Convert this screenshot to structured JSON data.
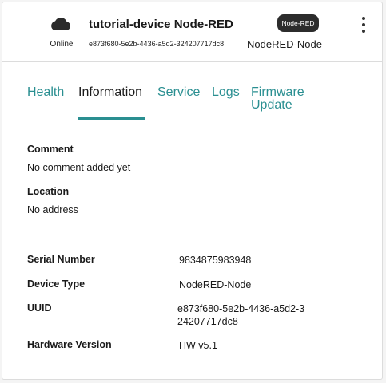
{
  "device": {
    "status": "Online",
    "name": "tutorial-device Node-RED",
    "uuid": "e873f680-5e2b-4436-a5d2-324207717dc8",
    "badge": "Node-RED",
    "type": "NodeRED-Node",
    "status_icon": "cloud-icon",
    "menu_icon": "more-vertical-icon"
  },
  "tabs": [
    {
      "label": "Health",
      "active": false
    },
    {
      "label": "Information",
      "active": true
    },
    {
      "label": "Service",
      "active": false
    },
    {
      "label": "Logs",
      "active": false
    },
    {
      "label": "Firmware Update",
      "active": false
    }
  ],
  "info": {
    "comment_label": "Comment",
    "comment_value": "No comment added yet",
    "location_label": "Location",
    "location_value": "No address",
    "rows": [
      {
        "label": "Serial Number",
        "value": "9834875983948"
      },
      {
        "label": "Device Type",
        "value": "NodeRED-Node"
      },
      {
        "label": "UUID",
        "value": "e873f680-5e2b-4436-a5d2-324207717dc8"
      },
      {
        "label": "Hardware Version",
        "value": "HW v5.1"
      }
    ]
  },
  "colors": {
    "accent": "#2a8f91",
    "badge_bg": "#2c2c2c",
    "border": "#dcdcdc"
  }
}
